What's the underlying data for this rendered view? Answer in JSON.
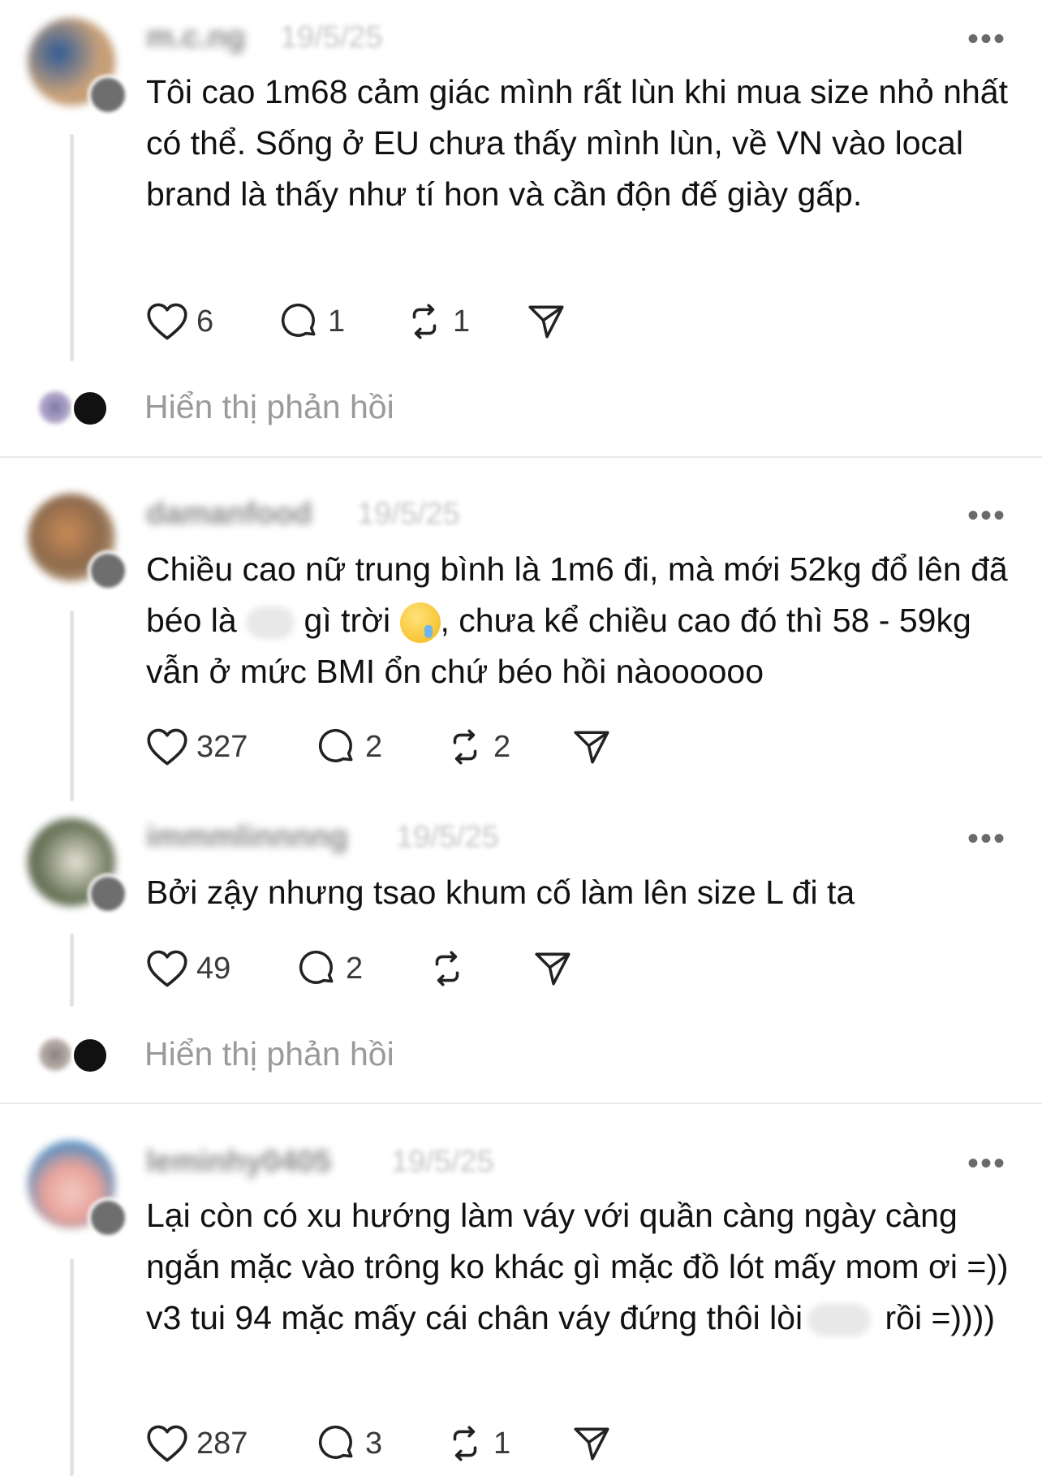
{
  "posts": [
    {
      "username": "m.c.ng",
      "date": "19/5/25",
      "more": "•••",
      "text": "Tôi cao 1m68 cảm giác mình rất lùn khi mua size nhỏ nhất có thể. Sống ở EU chưa thấy mình lùn, về VN vào local brand là thấy như tí hon và cần độn đế giày gấp.",
      "likes": "6",
      "replies": "1",
      "reposts": "1",
      "show_replies": "Hiển thị phản hồi"
    },
    {
      "username": "damanfood",
      "date": "19/5/25",
      "more": "•••",
      "text_part1": "Chiều cao nữ trung bình là 1m6 đi, mà mới 52kg đổ lên đã béo là ",
      "text_part2": " gì trời ",
      "text_part3": ", chưa kể chiều cao đó thì 58 - 59kg vẫn ở mức BMI ổn chứ béo hồi nàoooooo",
      "likes": "327",
      "replies": "2",
      "reposts": "2"
    },
    {
      "username": "immmlinnnng",
      "date": "19/5/25",
      "more": "•••",
      "text": "Bởi zậy nhưng tsao khum cố làm lên size L đi ta",
      "likes": "49",
      "replies": "2",
      "reposts": "",
      "show_replies": "Hiển thị phản hồi"
    },
    {
      "username": "leminhy0405",
      "date": "19/5/25",
      "more": "•••",
      "text_part1": "Lại còn có xu hướng làm váy với quần càng ngày càng ngắn mặc vào trông ko khác gì mặc đồ lót mấy mom ơi =)) v3 tui 94 mặc mấy cái chân váy đứng thôi lòi",
      "text_part2": " rồi =))))",
      "likes": "287",
      "replies": "3",
      "reposts": "1"
    }
  ],
  "icons": {
    "like": "heart-icon",
    "reply": "comment-icon",
    "repost": "repost-icon",
    "share": "send-icon",
    "more": "more-icon"
  },
  "colors": {
    "text": "#111111",
    "muted": "#9a9a9a",
    "divider": "#e9e9e9",
    "thread_line": "#e3e3e3"
  }
}
